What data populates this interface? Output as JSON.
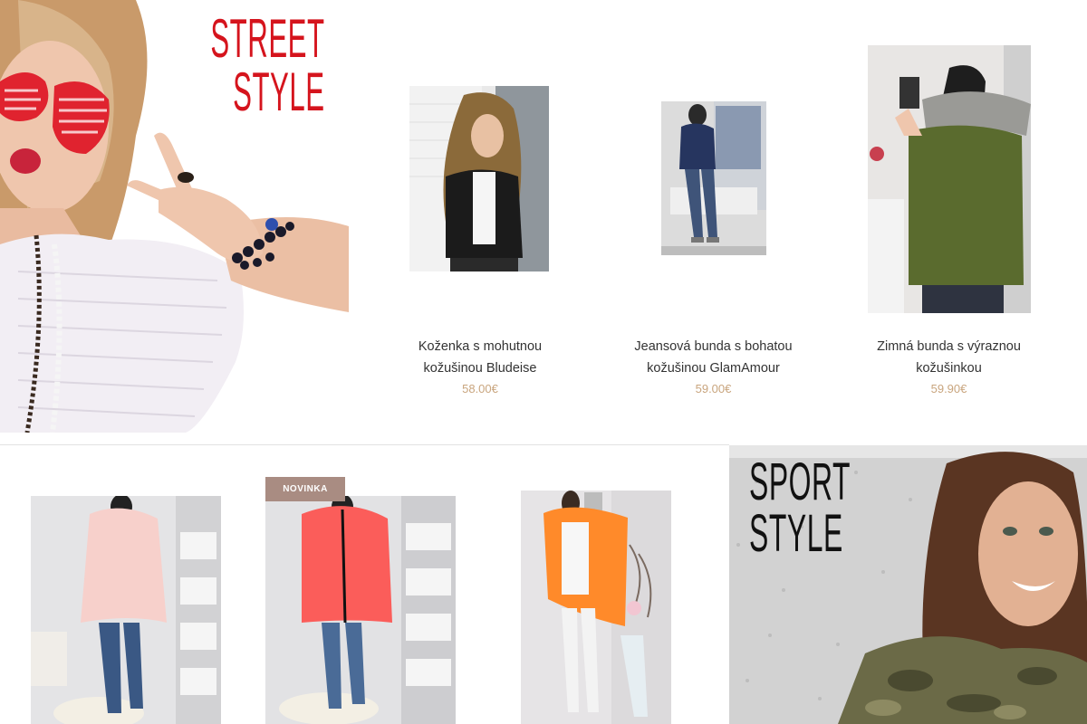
{
  "street_banner": {
    "line1": "STREET",
    "line2": "STYLE"
  },
  "sport_banner": {
    "line1": "SPORT",
    "line2": "STYLE"
  },
  "products": [
    {
      "name_line1": "Koženka s mohutnou",
      "name_line2": "kožušinou Bludeise",
      "price": "58.00€"
    },
    {
      "name_line1": "Jeansová bunda s bohatou",
      "name_line2": "kožušinou GlamAmour",
      "price": "59.00€"
    },
    {
      "name_line1": "Zimná bunda s výraznou",
      "name_line2": "kožušinkou",
      "price": "59.90€"
    }
  ],
  "bottom_products": [
    {
      "badge": ""
    },
    {
      "badge": "NOVINKA"
    },
    {
      "badge": ""
    }
  ],
  "colors": {
    "street_red": "#d5141d",
    "price_tan": "#c9a57e",
    "badge_bg": "#a98c82"
  }
}
